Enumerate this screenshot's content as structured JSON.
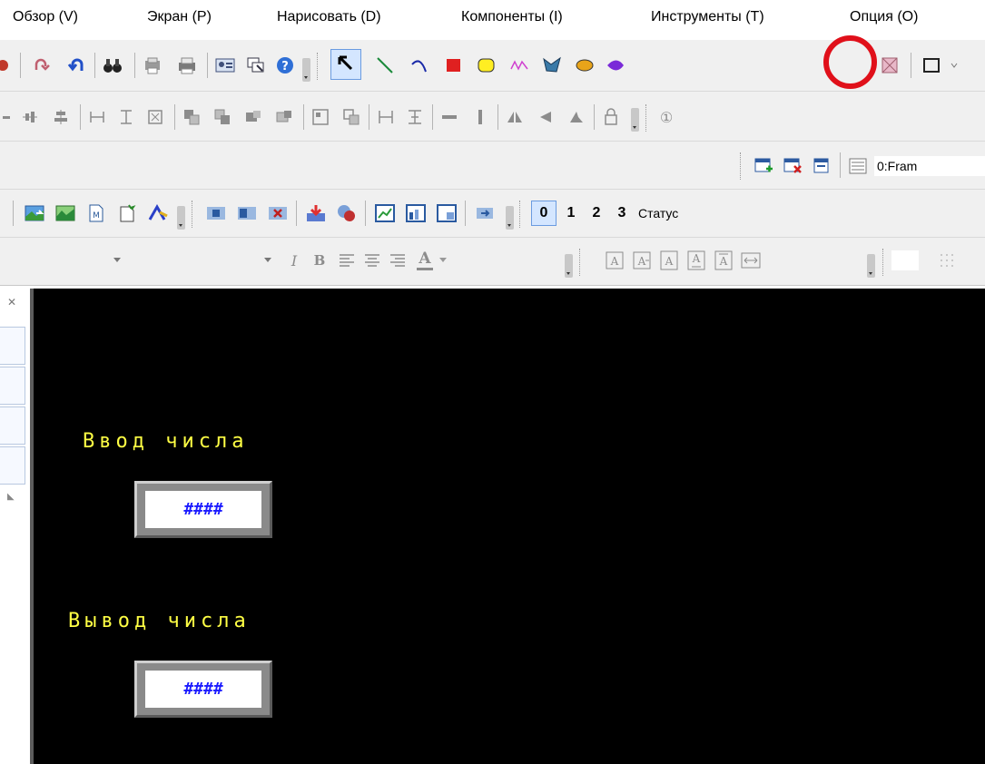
{
  "menu": [
    {
      "label": "Обзор (V)"
    },
    {
      "label": "Экран (P)"
    },
    {
      "label": "Нарисовать (D)"
    },
    {
      "label": "Компоненты (I)"
    },
    {
      "label": "Инструменты (T)"
    },
    {
      "label": "Опция (O)"
    }
  ],
  "toolbar": {
    "text_tool_glyph": "A",
    "frame_label": "0:Fram",
    "layers": [
      "0",
      "1",
      "2",
      "3"
    ],
    "status_label": "Статус",
    "italic_glyph": "I",
    "bold_glyph": "B",
    "font_color_glyph": "A",
    "circled_number": "①"
  },
  "canvas": {
    "background": "#000000",
    "label_color": "#ffff44",
    "input_label": "Ввод числа",
    "output_label": "Вывод числа",
    "input_value": "####",
    "output_value": "####"
  },
  "colors": {
    "highlight": "#e0101a",
    "toolbar_bg": "#f0f0f0"
  }
}
